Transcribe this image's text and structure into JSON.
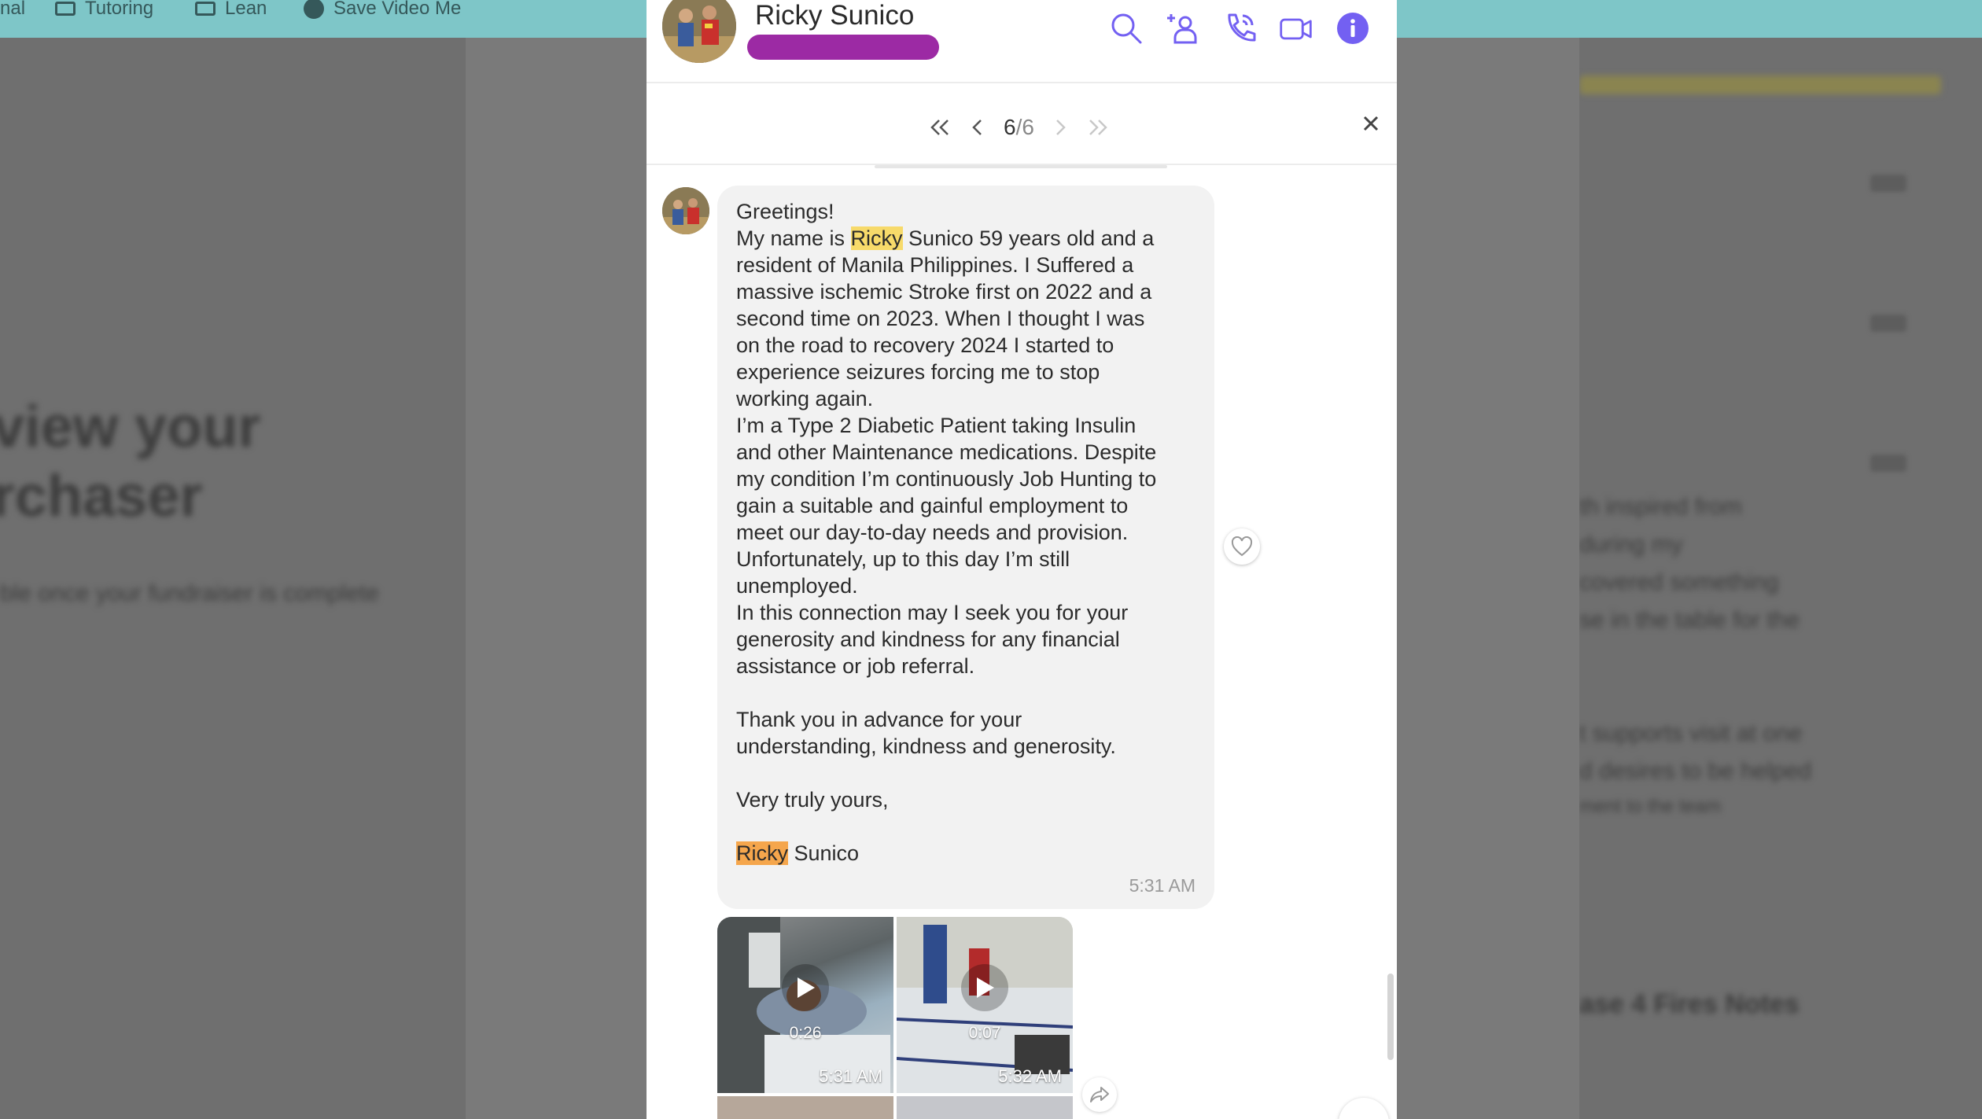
{
  "bookmarks": [
    {
      "label": "nal",
      "icon": "none"
    },
    {
      "label": "Tutoring",
      "icon": "folder-icon"
    },
    {
      "label": "Lean",
      "icon": "folder-icon"
    },
    {
      "label": "Save Video Me",
      "icon": "globe-icon"
    }
  ],
  "background_page": {
    "heading_line1": "view your",
    "heading_line2": "rchaser",
    "subtext": "ble once your fundraiser is complete",
    "right_lines": [
      "th inspired from",
      "during my",
      "covered something",
      "se in the table for the",
      "t supports visit at one",
      "d desires to be helped",
      "ment to the team",
      "ase 4 Fires Notes"
    ]
  },
  "header": {
    "contact_name": "Ricky Sunico",
    "status_color": "#9c2aa4",
    "icons": [
      "search-icon",
      "add-contact-icon",
      "phone-icon",
      "video-icon",
      "info-icon"
    ],
    "accent_color": "#7360f2"
  },
  "search_nav": {
    "current": "6",
    "separator": "/",
    "total": "6"
  },
  "message": {
    "text_part1": "Greetings!\nMy name is ",
    "highlight1": "Ricky",
    "text_part2": " Sunico 59 years old and a\nresident of Manila Philippines. I Suffered a\nmassive ischemic Stroke first on 2022 and a\nsecond time on 2023. When I thought I was\non the road to recovery 2024 I started to\nexperience seizures forcing me to stop\nworking again.\nI’m a Type 2 Diabetic Patient taking Insulin\nand other Maintenance medications. Despite\nmy condition I’m continuously Job Hunting to\ngain a suitable and gainful employment to\nmeet our day-to-day needs and provision.\nUnfortunately, up to this day I’m still\nunemployed.\nIn this connection may I seek you for your\ngenerosity and kindness for any financial\nassistance or job referral.\n\nThank you in advance for your\nunderstanding, kindness and generosity.\n\nVery truly yours,\n\n",
    "highlight2": "Ricky",
    "text_part3": " Sunico",
    "time": "5:31 AM"
  },
  "media": [
    {
      "duration": "0:26",
      "time": "5:31 AM"
    },
    {
      "duration": "0:07",
      "time": "5:32 AM"
    }
  ]
}
